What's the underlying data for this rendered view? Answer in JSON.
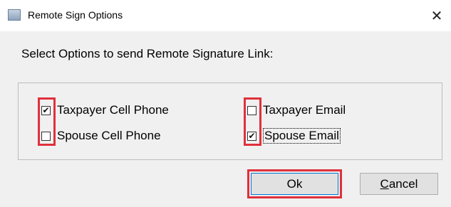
{
  "window": {
    "title": "Remote Sign Options",
    "close_glyph": "✕",
    "app_icon": "window-icon"
  },
  "instruction": "Select Options to send Remote Signature Link:",
  "options": {
    "taxpayer_cell": {
      "label": "Taxpayer Cell Phone",
      "checked": true
    },
    "spouse_cell": {
      "label": "Spouse Cell Phone",
      "checked": false
    },
    "taxpayer_email": {
      "label": "Taxpayer Email",
      "checked": false
    },
    "spouse_email": {
      "label": "Spouse Email",
      "checked": true
    }
  },
  "buttons": {
    "ok_label": "Ok",
    "cancel_accel": "C",
    "cancel_rest": "ancel"
  },
  "check_glyph": "✔",
  "colors": {
    "highlight": "#e0303b",
    "dialog_bg": "#f0f0f0",
    "ok_border": "#0078d7"
  }
}
